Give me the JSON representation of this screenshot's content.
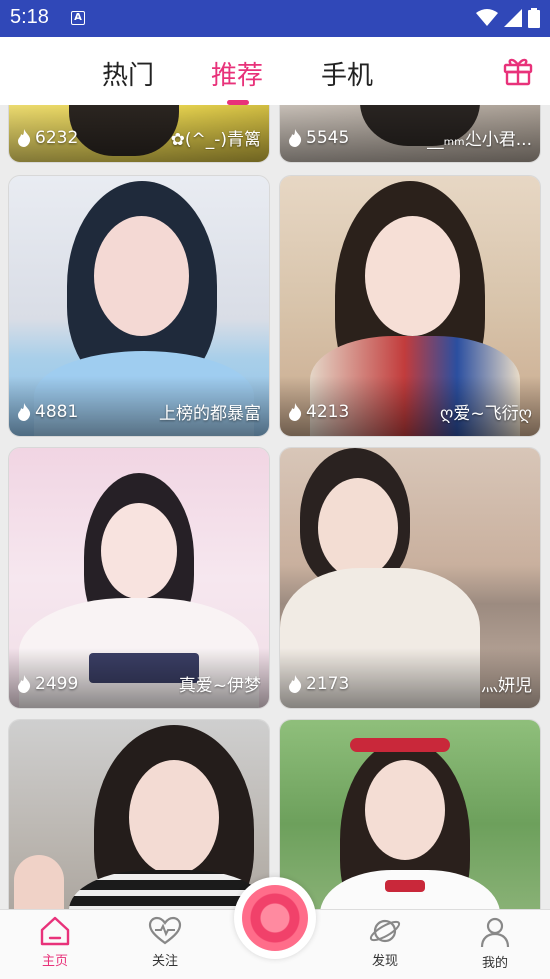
{
  "status_bar": {
    "time": "5:18",
    "notif_glyph": "A"
  },
  "tabs": [
    {
      "label": "热门",
      "active": false
    },
    {
      "label": "推荐",
      "active": true
    },
    {
      "label": "手机",
      "active": false
    }
  ],
  "gift_icon": "gift-icon",
  "cards": [
    {
      "heat": "6232",
      "name": "✿(^_-)青篱"
    },
    {
      "heat": "5545",
      "name": "__ₘₘ尐小君..."
    },
    {
      "heat": "4881",
      "name": "上榜的都暴富"
    },
    {
      "heat": "4213",
      "name": "ღ爱~飞衍ღ"
    },
    {
      "heat": "2499",
      "name": "真爱~伊梦"
    },
    {
      "heat": "2173",
      "name": "灬妍児"
    },
    {
      "heat": "",
      "name": ""
    },
    {
      "heat": "",
      "name": ""
    }
  ],
  "bottom_nav": {
    "home": "主页",
    "follow": "关注",
    "discover": "发现",
    "mine": "我的"
  },
  "colors": {
    "accent": "#e8327a",
    "status_bar": "#3048b8"
  }
}
